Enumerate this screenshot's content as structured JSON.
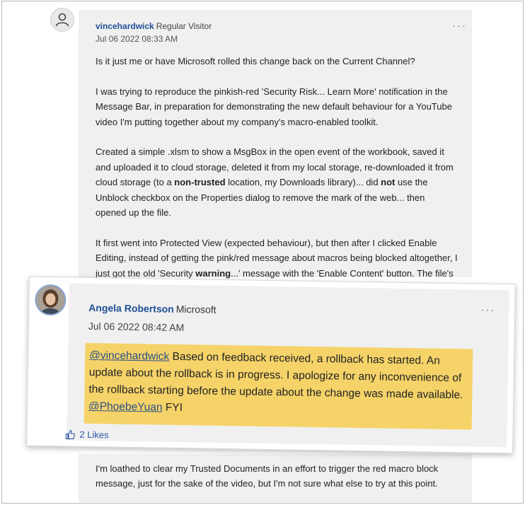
{
  "post": {
    "username": "vincehardwick",
    "role": "Regular Visitor",
    "date": "Jul 06 2022 08:33 AM",
    "menu": "···",
    "p1": "Is it just me or have Microsoft rolled this change back on the Current Channel?",
    "p2": "I was trying to reproduce the pinkish-red 'Security Risk... Learn More' notification in the Message Bar, in preparation for demonstrating the new default behaviour for a YouTube video I'm putting together about my company's macro-enabled toolkit.",
    "p3_a": "Created a simple .xlsm to show a MsgBox in the open event of the workbook, saved it and uploaded it to cloud storage, deleted it from my local storage, re-downloaded it from cloud storage (to a ",
    "p3_b": "non-trusted",
    "p3_c": " location, my Downloads library)... did ",
    "p3_d": "not",
    "p3_e": " use the Unblock checkbox on the Properties dialog to remove the mark of the web... then opened up the file.",
    "p4_a": "It first went into Protected View (expected behaviour), but then after I clicked Enable Editing, instead of getting the pink/red message about macros being blocked altogether, I just got the old 'Security ",
    "p4_b": "warning",
    "p4_c": "...' message with the 'Enable Content' button. The file's VBA project wasn't digitally signed, wasn't saved to a Trusted Location, and still had the mark of the web",
    "p5": "I'm loathed to clear my Trusted Documents in an effort to trigger the red macro block message, just for the sake of the video, but I'm not sure what else to try at this point."
  },
  "reply": {
    "username": "Angela Robertson",
    "role": "Microsoft",
    "date": "Jul 06 2022 08:42 AM",
    "menu": "···",
    "mention1": "@vincehardwick",
    "text_main": " Based on feedback received, a rollback has started. An update about the rollback is in progress. I apologize for any inconvenience of the rollback starting before the update about the change was made available. ",
    "mention2": "@PhoebeYuan",
    "text_tail": " FYI",
    "likes": "2 Likes",
    "highlight_color": "#f5d369"
  },
  "icons": [
    "user-avatar-icon",
    "more-options-icon",
    "thumbs-up-icon"
  ]
}
